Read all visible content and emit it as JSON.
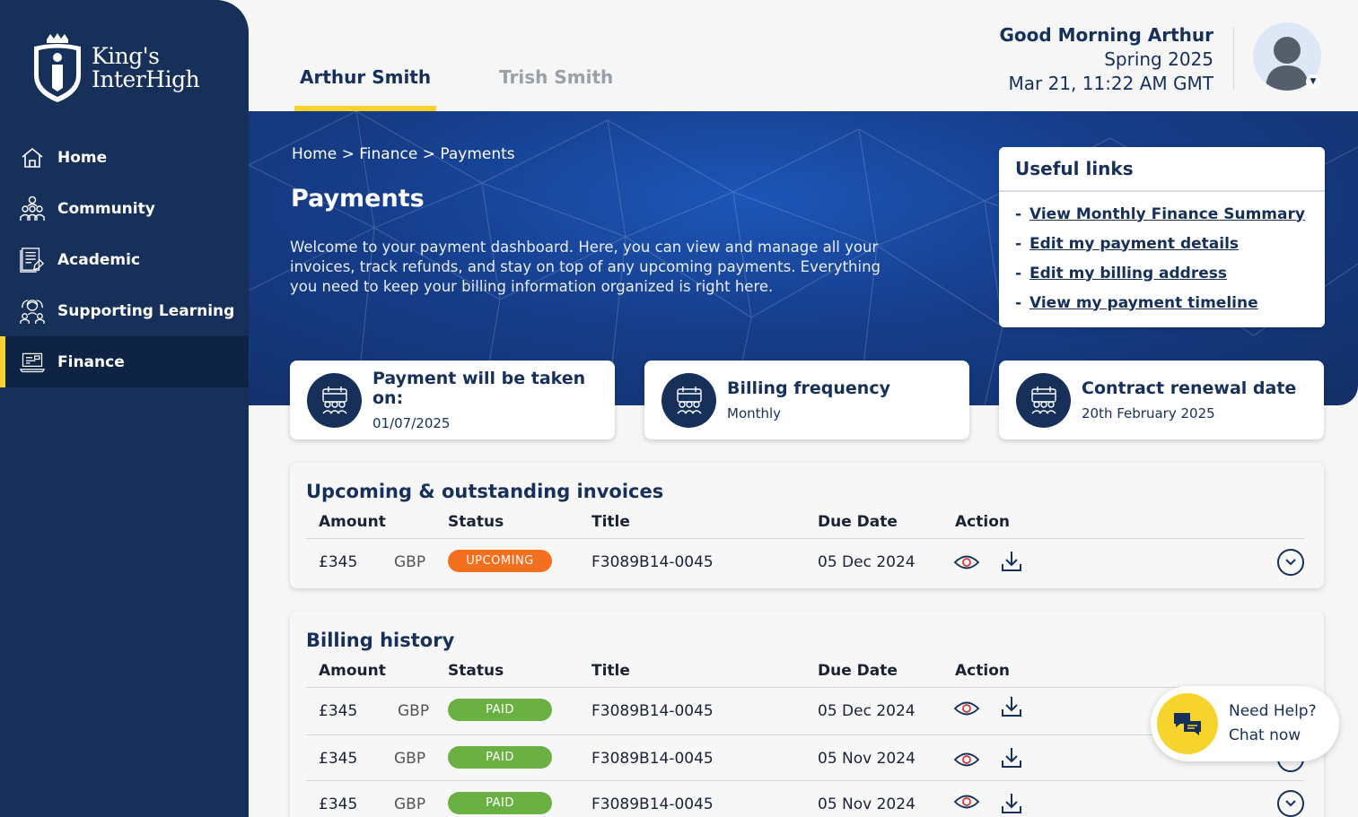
{
  "brand": {
    "line1": "King's",
    "line2": "InterHigh"
  },
  "sidebar": {
    "items": [
      {
        "label": "Home",
        "icon": "home-icon"
      },
      {
        "label": "Community",
        "icon": "community-icon"
      },
      {
        "label": "Academic",
        "icon": "academic-icon"
      },
      {
        "label": "Supporting Learning",
        "icon": "supporting-learning-icon"
      },
      {
        "label": "Finance",
        "icon": "finance-icon",
        "active": true
      }
    ]
  },
  "header": {
    "tabs": [
      {
        "label": "Arthur Smith",
        "active": true
      },
      {
        "label": "Trish Smith",
        "active": false
      }
    ],
    "greeting": "Good Morning Arthur",
    "term": "Spring 2025",
    "datetime": "Mar 21, 11:22 AM GMT"
  },
  "hero": {
    "breadcrumb": [
      "Home",
      "Finance",
      "Payments"
    ],
    "separator": ">",
    "title": "Payments",
    "description": "Welcome to your payment dashboard. Here, you can view and manage all your invoices, track refunds, and stay on top of any upcoming payments. Everything you need to keep your billing information organized is right here."
  },
  "useful_links": {
    "title": "Useful links",
    "links": [
      "View Monthly Finance Summary",
      "Edit my payment details",
      "Edit my billing address",
      "View my payment timeline"
    ]
  },
  "cards": [
    {
      "label": "Payment will be taken on:",
      "value": "01/07/2025"
    },
    {
      "label": "Billing frequency",
      "value": "Monthly"
    },
    {
      "label": "Contract renewal date",
      "value": "20th February 2025"
    }
  ],
  "columns": {
    "amount": "Amount",
    "status": "Status",
    "title": "Title",
    "due": "Due Date",
    "action": "Action"
  },
  "upcoming": {
    "title": "Upcoming & outstanding invoices",
    "rows": [
      {
        "amount": "£345",
        "currency": "GBP",
        "status": "UPCOMING",
        "title": "F3089B14-0045",
        "due": "05 Dec 2024"
      }
    ]
  },
  "history": {
    "title": "Billing history",
    "rows": [
      {
        "amount": "£345",
        "currency": "GBP",
        "status": "PAID",
        "title": "F3089B14-0045",
        "due": "05 Dec 2024"
      },
      {
        "amount": "£345",
        "currency": "GBP",
        "status": "PAID",
        "title": "F3089B14-0045",
        "due": "05 Nov 2024"
      },
      {
        "amount": "£345",
        "currency": "GBP",
        "status": "PAID",
        "title": "F3089B14-0045",
        "due": "05 Nov 2024"
      }
    ]
  },
  "chat": {
    "line1": "Need Help?",
    "line2": "Chat now"
  },
  "colors": {
    "navy": "#16305a",
    "accent": "#f6d32d",
    "upcoming": "#f46f1e",
    "paid": "#6ab043"
  }
}
